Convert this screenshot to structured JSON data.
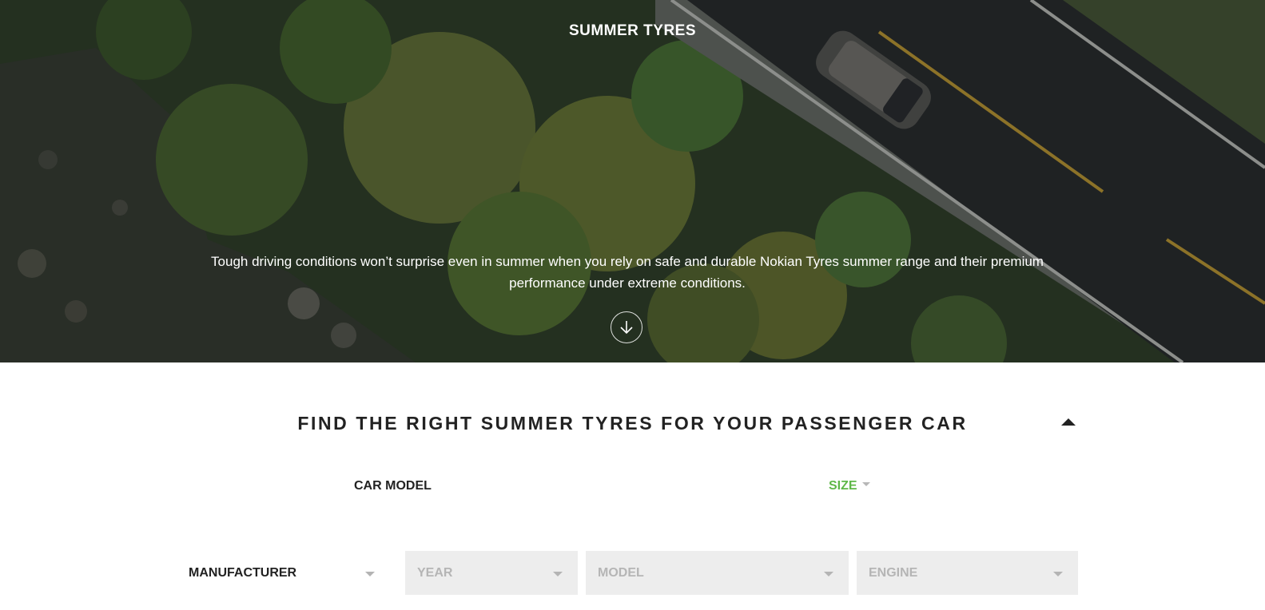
{
  "hero": {
    "title": "SUMMER TYRES",
    "description": "Tough driving conditions won’t surprise even in summer when you rely on safe and durable Nokian Tyres summer range and their premium performance under extreme conditions."
  },
  "finder": {
    "title": "FIND THE RIGHT SUMMER TYRES FOR YOUR PASSENGER CAR",
    "modes": {
      "car_model": "CAR MODEL",
      "size": "SIZE"
    },
    "selects": {
      "manufacturer": "MANUFACTURER",
      "year": "YEAR",
      "model": "MODEL",
      "engine": "ENGINE"
    }
  },
  "colors": {
    "accent_green": "#5fb848",
    "text_dark": "#222222",
    "disabled_bg": "#ededed",
    "disabled_text": "#b5b5b5"
  }
}
